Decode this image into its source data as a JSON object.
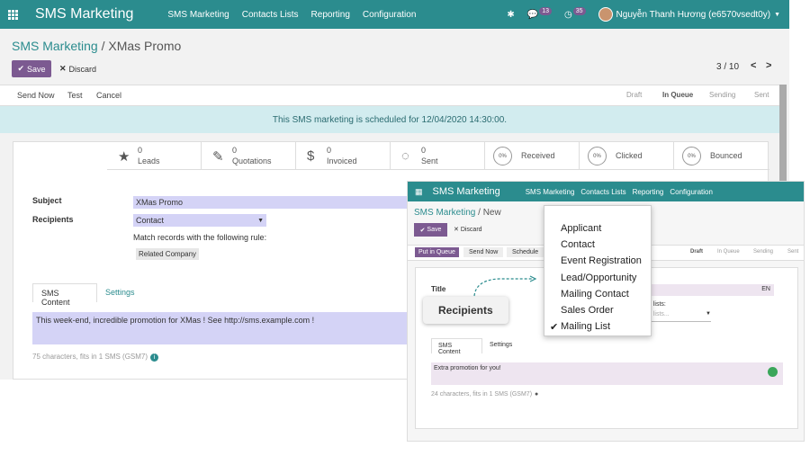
{
  "nav": {
    "brand": "SMS Marketing",
    "menus": [
      "SMS Marketing",
      "Contacts Lists",
      "Reporting",
      "Configuration"
    ],
    "chat_count": "13",
    "activity_count": "35",
    "user": "Nguyễn Thanh Hương (e6570vsedt0y)"
  },
  "breadcrumb": {
    "parent": "SMS Marketing",
    "sep": "/",
    "current": "XMas Promo"
  },
  "toolbar": {
    "save": "Save",
    "discard": "Discard",
    "pager": "3 / 10"
  },
  "actions": [
    "Send Now",
    "Test",
    "Cancel"
  ],
  "stages": [
    "Draft",
    "In Queue",
    "Sending",
    "Sent"
  ],
  "alert": "This SMS marketing is scheduled for 12/04/2020 14:30:00.",
  "stats": [
    {
      "value": "0",
      "label": "Leads",
      "icon": "star-icon"
    },
    {
      "value": "0",
      "label": "Quotations",
      "icon": "pencil-icon"
    },
    {
      "value": "0",
      "label": "Invoiced",
      "icon": "dollar-icon"
    },
    {
      "value": "0",
      "label": "Sent",
      "icon": "chat-icon"
    }
  ],
  "rates": [
    {
      "value": "0%",
      "label": "Received"
    },
    {
      "value": "0%",
      "label": "Clicked"
    },
    {
      "value": "0%",
      "label": "Bounced"
    }
  ],
  "form": {
    "subject_label": "Subject",
    "subject": "XMas Promo",
    "recipients_label": "Recipients",
    "recipients": "Contact",
    "rule_text": "Match records with the following rule:",
    "rule_tag": "Related Company"
  },
  "tabs": [
    "SMS Content",
    "Settings"
  ],
  "body": "This week-end, incredible promotion for XMas ! See http://sms.example.com !",
  "chars": "75 characters, fits in 1 SMS (GSM7)",
  "overlay": {
    "brand": "SMS Marketing",
    "menus": [
      "SMS Marketing",
      "Contacts Lists",
      "Reporting",
      "Configuration"
    ],
    "crumb_parent": "SMS Marketing",
    "crumb_current": "New",
    "save": "Save",
    "discard": "Discard",
    "actions": [
      "Put in Queue",
      "Send Now",
      "Schedule"
    ],
    "stages": [
      "Draft",
      "In Queue",
      "Sending",
      "Sent"
    ],
    "title_label": "Title",
    "lang": "EN",
    "lists_label": "g lists:",
    "lists_placeholder": "g lists...",
    "tabs": [
      "SMS Content",
      "Settings"
    ],
    "body": "Extra promotion for you!",
    "chars": "24 characters, fits in 1 SMS (GSM7)"
  },
  "dropdown": {
    "items": [
      "Applicant",
      "Contact",
      "Event Registration",
      "Lead/Opportunity",
      "Mailing Contact",
      "Sales Order",
      "Mailing List"
    ],
    "selected_index": 6
  },
  "callout": "Recipients"
}
